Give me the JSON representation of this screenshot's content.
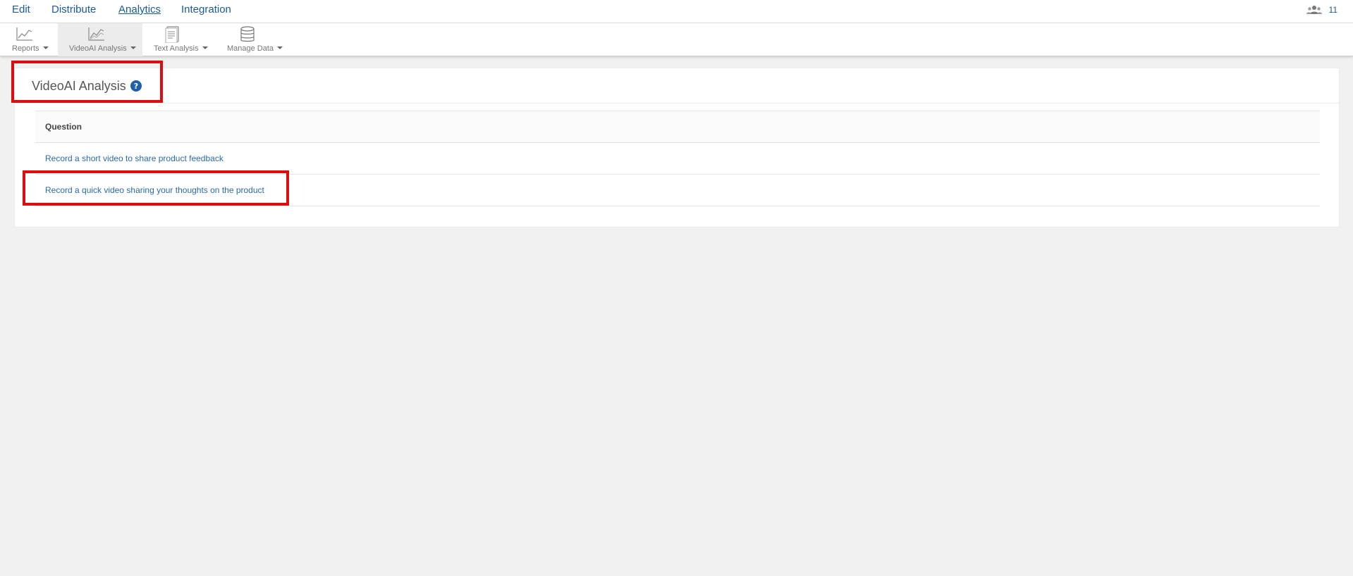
{
  "topnav": {
    "items": [
      {
        "label": "Edit"
      },
      {
        "label": "Distribute"
      },
      {
        "label": "Analytics"
      },
      {
        "label": "Integration"
      }
    ],
    "active": "Analytics",
    "user_count": "11"
  },
  "toolbar": {
    "items": [
      {
        "label": "Reports",
        "icon": "line-chart-icon"
      },
      {
        "label": "VideoAI Analysis",
        "icon": "video-analysis-chart-icon"
      },
      {
        "label": "Text Analysis",
        "icon": "text-document-icon"
      },
      {
        "label": "Manage Data",
        "icon": "database-icon"
      }
    ],
    "active": "VideoAI Analysis"
  },
  "panel": {
    "title": "VideoAI Analysis",
    "table": {
      "header": "Question",
      "rows": [
        "Record a short video to share product feedback",
        "Record a quick video sharing your thoughts on the product"
      ]
    }
  },
  "colors": {
    "link": "#1a5a96",
    "highlight": "#dd0d0d",
    "background": "#f1f1f1",
    "help_icon": "#1f5fa8"
  }
}
